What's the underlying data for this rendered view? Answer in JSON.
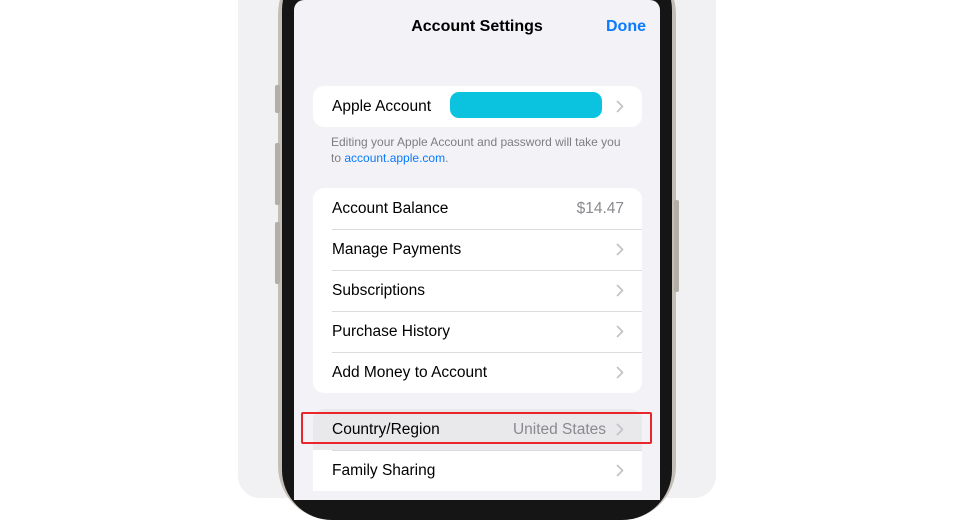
{
  "nav": {
    "title": "Account Settings",
    "done_label": "Done"
  },
  "account_group": {
    "label": "Apple Account"
  },
  "footnote": {
    "text": "Editing your Apple Account and password will take you to ",
    "link": "account.apple.com",
    "end": "."
  },
  "payments_group": {
    "items": [
      {
        "label": "Account Balance",
        "value": "$14.47"
      },
      {
        "label": "Manage Payments"
      },
      {
        "label": "Subscriptions"
      },
      {
        "label": "Purchase History"
      },
      {
        "label": "Add Money to Account"
      }
    ]
  },
  "region_group": {
    "items": [
      {
        "label": "Country/Region",
        "value": "United States"
      },
      {
        "label": "Family Sharing"
      }
    ]
  },
  "colors": {
    "accent": "#0a7aff",
    "highlight": "#e8262c",
    "redaction": "#0cc3df"
  }
}
